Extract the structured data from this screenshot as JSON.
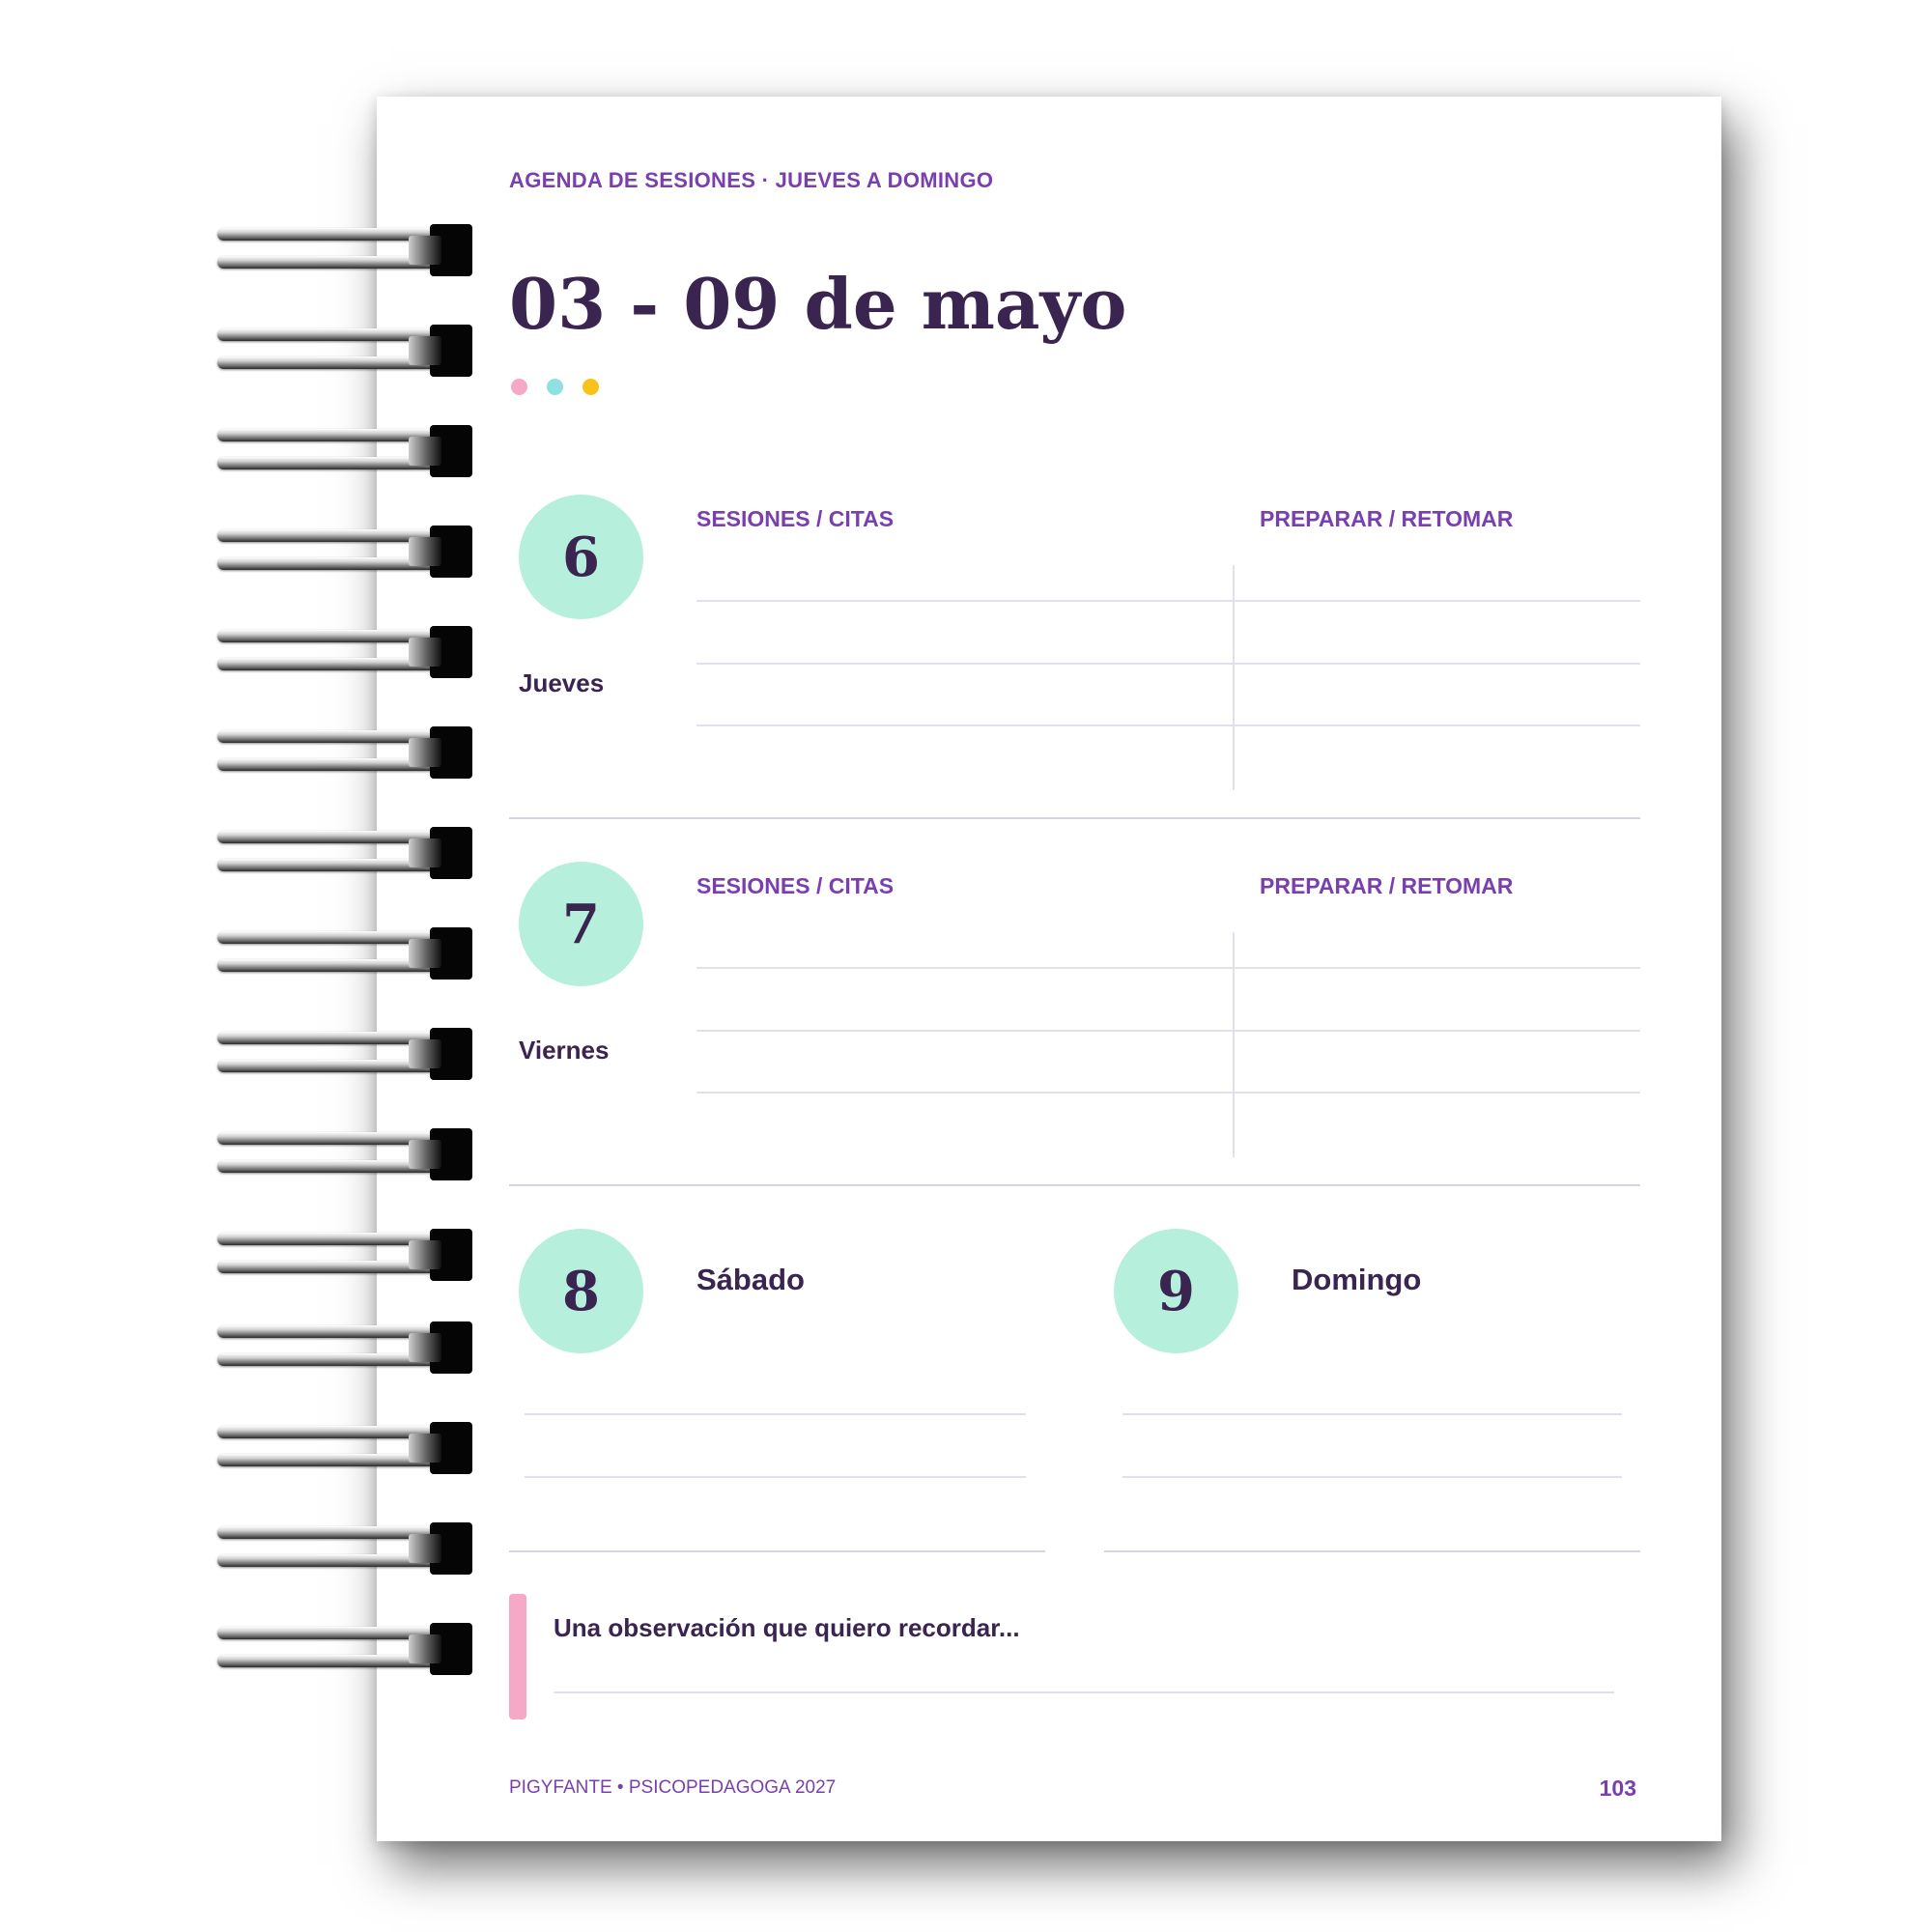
{
  "header": {
    "kicker": "AGENDA DE SESIONES · JUEVES A DOMINGO",
    "title": "03 - 09 de mayo"
  },
  "accent_dots": [
    "#f6a9c6",
    "#8fe0e0",
    "#f7c21a"
  ],
  "days": [
    {
      "number": "6",
      "name": "Jueves",
      "col1": "SESIONES / CITAS",
      "col2": "PREPARAR / RETOMAR"
    },
    {
      "number": "7",
      "name": "Viernes",
      "col1": "SESIONES / CITAS",
      "col2": "PREPARAR / RETOMAR"
    }
  ],
  "weekend": [
    {
      "number": "8",
      "name": "Sábado"
    },
    {
      "number": "9",
      "name": "Domingo"
    }
  ],
  "note": {
    "prompt": "Una observación que quiero recordar..."
  },
  "footer": {
    "brand": "PIGYFANTE  •  PSICOPEDAGOGA 2027",
    "page_number": "103"
  },
  "colors": {
    "accent_purple": "#7a3fae",
    "text_dark": "#3a2450",
    "mint": "#b6f0dd",
    "pink": "#f6a9c6"
  }
}
